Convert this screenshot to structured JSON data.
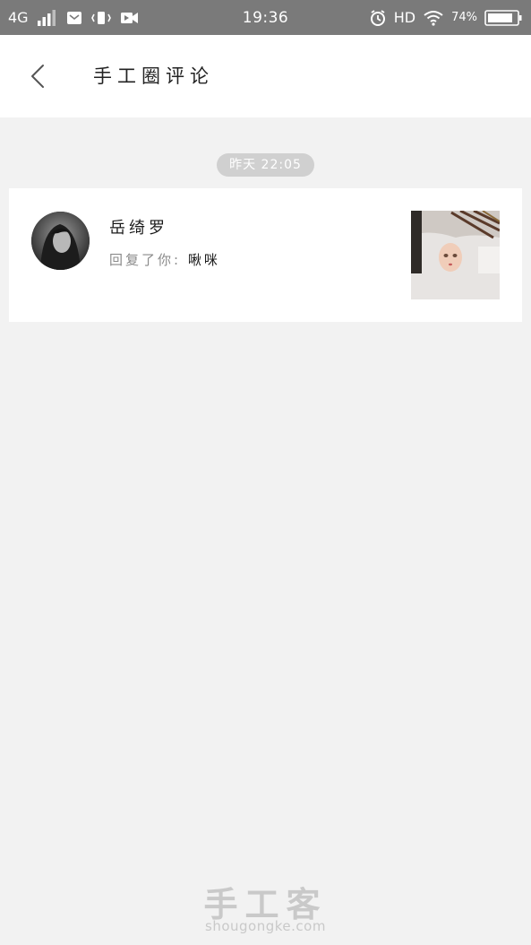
{
  "status_bar": {
    "network": "4G",
    "time": "19:36",
    "hd": "HD",
    "battery": "74%",
    "icons": [
      "signal-icon",
      "mail-icon",
      "vibrate-icon",
      "video-icon",
      "alarm-icon",
      "wifi-icon",
      "battery-icon"
    ]
  },
  "header": {
    "back_icon": "chevron-left-icon",
    "title": "手工圈评论"
  },
  "timestamp": "昨天 22:05",
  "notification": {
    "username": "岳绮罗",
    "reply_prefix": "回复了你:",
    "reply_content": "啾咪"
  },
  "watermark": {
    "title": "手工客",
    "subtitle": "shougongke.com"
  },
  "colors": {
    "statusbar_bg": "#7a7a7a",
    "page_bg": "#f2f2f2",
    "card_bg": "#ffffff",
    "pill_bg": "#d0d0d0"
  }
}
